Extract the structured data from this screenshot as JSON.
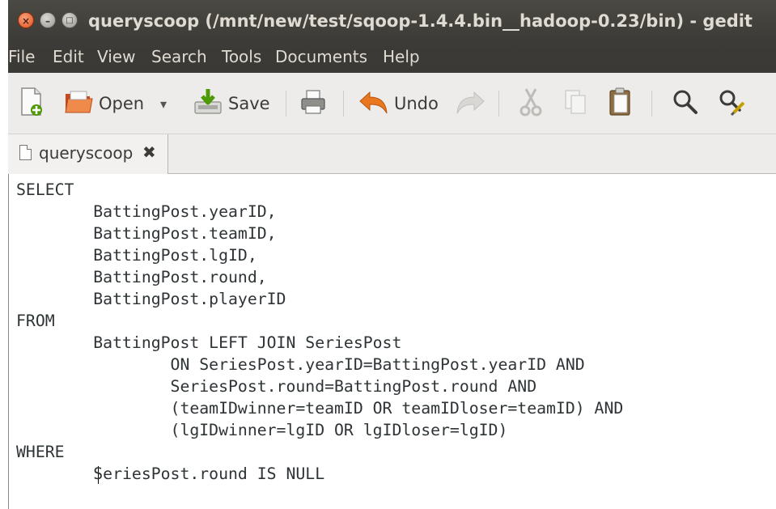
{
  "window": {
    "title": "queryscoop (/mnt/new/test/sqoop-1.4.4.bin__hadoop-0.23/bin) - gedit",
    "buttons": {
      "close": "×",
      "minimize": "–",
      "maximize": "□"
    }
  },
  "menu": [
    "File",
    "Edit",
    "View",
    "Search",
    "Tools",
    "Documents",
    "Help"
  ],
  "toolbar": {
    "open_label": "Open",
    "open_dropdown": "▾",
    "save_label": "Save",
    "undo_label": "Undo"
  },
  "tab": {
    "label": "queryscoop",
    "close": "✖"
  },
  "editor": {
    "lines": [
      "SELECT",
      "        BattingPost.yearID,",
      "        BattingPost.teamID,",
      "        BattingPost.lgID,",
      "        BattingPost.round,",
      "        BattingPost.playerID",
      "FROM",
      "        BattingPost LEFT JOIN SeriesPost",
      "                ON SeriesPost.yearID=BattingPost.yearID AND",
      "                SeriesPost.round=BattingPost.round AND",
      "                (teamIDwinner=teamID OR teamIDloser=teamID) AND",
      "                (lgIDwinner=lgID OR lgIDloser=lgID)",
      "WHERE",
      "        SeriesPost.round IS NULL"
    ]
  },
  "colors": {
    "titlebar": "#3c3b37",
    "menu_text": "#dfdbd2",
    "close_button": "#e2531f",
    "editor_bg": "#ffffff",
    "code_text": "#2e3436"
  }
}
